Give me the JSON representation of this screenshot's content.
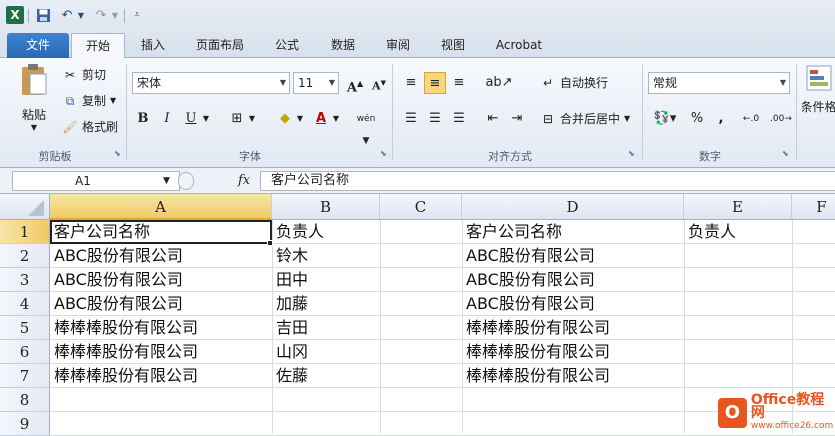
{
  "quick_access": {
    "app_icon": "X",
    "save_icon": "save-icon",
    "undo_icon": "undo-icon",
    "redo_icon": "redo-icon"
  },
  "tabs": [
    "文件",
    "开始",
    "插入",
    "页面布局",
    "公式",
    "数据",
    "审阅",
    "视图",
    "Acrobat"
  ],
  "ribbon": {
    "clipboard": {
      "paste": "粘贴",
      "cut": "剪切",
      "copy": "复制",
      "format_painter": "格式刷",
      "label": "剪贴板"
    },
    "font": {
      "name": "宋体",
      "size": "11",
      "grow": "A",
      "shrink": "A",
      "bold": "B",
      "italic": "I",
      "underline": "U",
      "phonetic": "wén",
      "label": "字体"
    },
    "alignment": {
      "wrap_text": "自动换行",
      "merge_center": "合并后居中",
      "label": "对齐方式"
    },
    "number": {
      "format": "常规",
      "percent": "%",
      "comma": ",",
      "label": "数字"
    },
    "styles": {
      "conditional": "条件格"
    }
  },
  "formula_bar": {
    "name_box": "A1",
    "fx": "fx",
    "content": "客户公司名称"
  },
  "sheet": {
    "columns": [
      "A",
      "B",
      "C",
      "D",
      "E",
      "F"
    ],
    "rows": [
      "1",
      "2",
      "3",
      "4",
      "5",
      "6",
      "7",
      "8",
      "9"
    ],
    "cells": [
      [
        "客户公司名称",
        "负责人",
        "",
        "客户公司名称",
        "负责人"
      ],
      [
        "ABC股份有限公司",
        "铃木",
        "",
        "ABC股份有限公司",
        ""
      ],
      [
        "ABC股份有限公司",
        "田中",
        "",
        "ABC股份有限公司",
        ""
      ],
      [
        "ABC股份有限公司",
        "加藤",
        "",
        "ABC股份有限公司",
        ""
      ],
      [
        "棒棒棒股份有限公司",
        "吉田",
        "",
        "棒棒棒股份有限公司",
        ""
      ],
      [
        "棒棒棒股份有限公司",
        "山冈",
        "",
        "棒棒棒股份有限公司",
        ""
      ],
      [
        "棒棒棒股份有限公司",
        "佐藤",
        "",
        "棒棒棒股份有限公司",
        ""
      ]
    ]
  },
  "watermark": {
    "logo": "O",
    "line1": "Office教程网",
    "line2": "www.office26.com"
  }
}
